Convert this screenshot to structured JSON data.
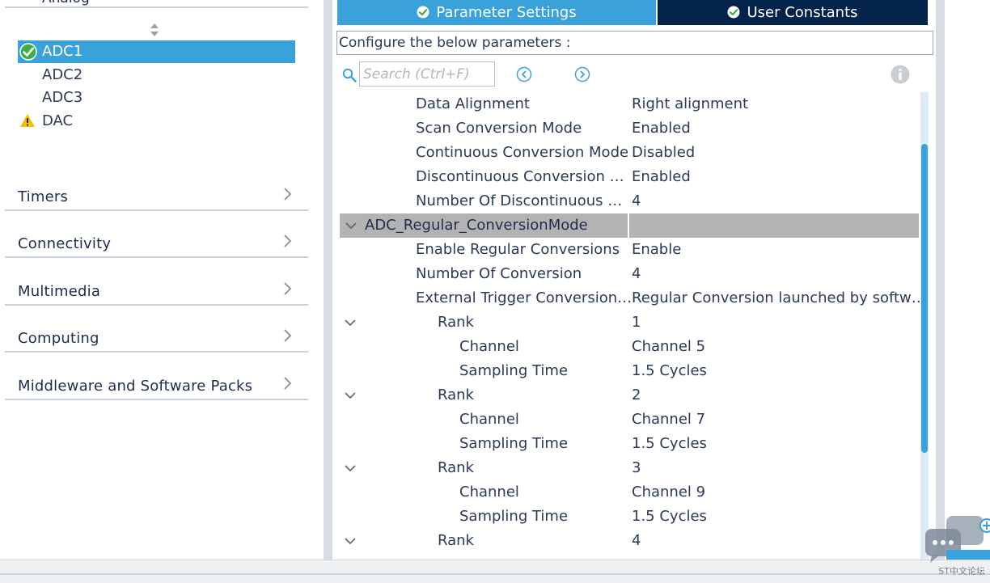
{
  "sidebar": {
    "top_label": "Analog",
    "items": [
      {
        "label": "ADC1",
        "status": "ok",
        "selected": true
      },
      {
        "label": "ADC2",
        "status": "none",
        "selected": false
      },
      {
        "label": "ADC3",
        "status": "none",
        "selected": false
      },
      {
        "label": "DAC",
        "status": "warning",
        "selected": false
      }
    ],
    "categories": [
      {
        "label": "Timers"
      },
      {
        "label": "Connectivity"
      },
      {
        "label": "Multimedia"
      },
      {
        "label": "Computing"
      },
      {
        "label": "Middleware and Software Packs"
      }
    ]
  },
  "tabs": [
    {
      "label": "Parameter Settings",
      "active": true
    },
    {
      "label": "User Constants",
      "active": false
    }
  ],
  "configure_text": "Configure the below parameters :",
  "search": {
    "placeholder": "Search (Ctrl+F)"
  },
  "params": [
    {
      "name": "Data Alignment",
      "value": "Right alignment"
    },
    {
      "name": "Scan Conversion Mode",
      "value": "Enabled"
    },
    {
      "name": "Continuous Conversion Mode",
      "value": "Disabled"
    },
    {
      "name": "Discontinuous Conversion …",
      "value": "Enabled"
    },
    {
      "name": "Number Of Discontinuous …",
      "value": "4"
    },
    {
      "group": "ADC_Regular_ConversionMode"
    },
    {
      "name": "Enable Regular Conversions",
      "value": "Enable"
    },
    {
      "name": "Number Of Conversion",
      "value": "4"
    },
    {
      "name": "External Trigger Conversion…",
      "value": "Regular Conversion launched by softw…"
    },
    {
      "name": "Rank",
      "value": "1",
      "expandable": true
    },
    {
      "name": "Channel",
      "value": "Channel 5"
    },
    {
      "name": "Sampling Time",
      "value": "1.5 Cycles"
    },
    {
      "name": "Rank",
      "value": "2",
      "expandable": true
    },
    {
      "name": "Channel",
      "value": "Channel 7"
    },
    {
      "name": "Sampling Time",
      "value": "1.5 Cycles"
    },
    {
      "name": "Rank",
      "value": "3",
      "expandable": true
    },
    {
      "name": "Channel",
      "value": "Channel 9"
    },
    {
      "name": "Sampling Time",
      "value": "1.5 Cycles"
    },
    {
      "name": "Rank",
      "value": "4",
      "expandable": true
    }
  ],
  "watermark": "ST中文论坛",
  "colors": {
    "accent": "#3aa1db",
    "tab_dark": "#03234b",
    "group_bg": "#b3b3b3",
    "warning": "#f2c200",
    "ok": "#3fae49"
  }
}
